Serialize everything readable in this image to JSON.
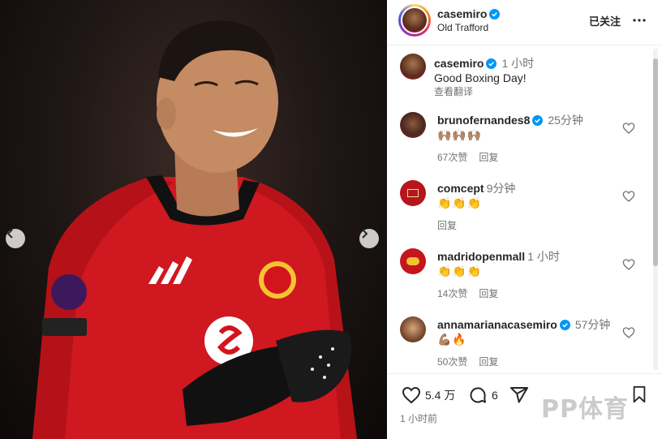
{
  "post": {
    "username": "casemiro",
    "location": "Old Trafford",
    "follow_status": "已关注",
    "caption": {
      "username": "casemiro",
      "time": "1 小时",
      "text": "Good Boxing Day!",
      "translate": "查看翻译"
    },
    "likes": "5.4 万",
    "comments_count": "6",
    "posted_ago": "1 小时前"
  },
  "photo": {
    "sleeve_badge_text": "No room for racism",
    "kit_color": "#d4141c"
  },
  "comments": [
    {
      "username": "brunofernandes8",
      "verified": true,
      "time": "25分钟",
      "emojis": "🙌🏽🙌🏽🙌🏽",
      "likes": "67次赞",
      "reply": "回复"
    },
    {
      "username": "comcept",
      "verified": false,
      "time": "9分钟",
      "emojis": "👏👏👏",
      "likes": "",
      "reply": "回复"
    },
    {
      "username": "madridopenmall",
      "verified": false,
      "time": "1 小时",
      "emojis": "👏👏👏",
      "likes": "14次赞",
      "reply": "回复"
    },
    {
      "username": "annamarianacasemiro",
      "verified": true,
      "time": "57分钟",
      "emojis": "💪🏽🔥",
      "likes": "50次赞",
      "reply": "回复"
    }
  ],
  "watermark": "PP体育",
  "colors": {
    "verified": "#0095f6",
    "text": "#262626",
    "muted": "#737373"
  },
  "icons": [
    "chevron-left-icon",
    "chevron-right-icon",
    "verified-icon",
    "more-icon",
    "heart-icon",
    "comment-icon",
    "share-icon",
    "bookmark-icon"
  ]
}
